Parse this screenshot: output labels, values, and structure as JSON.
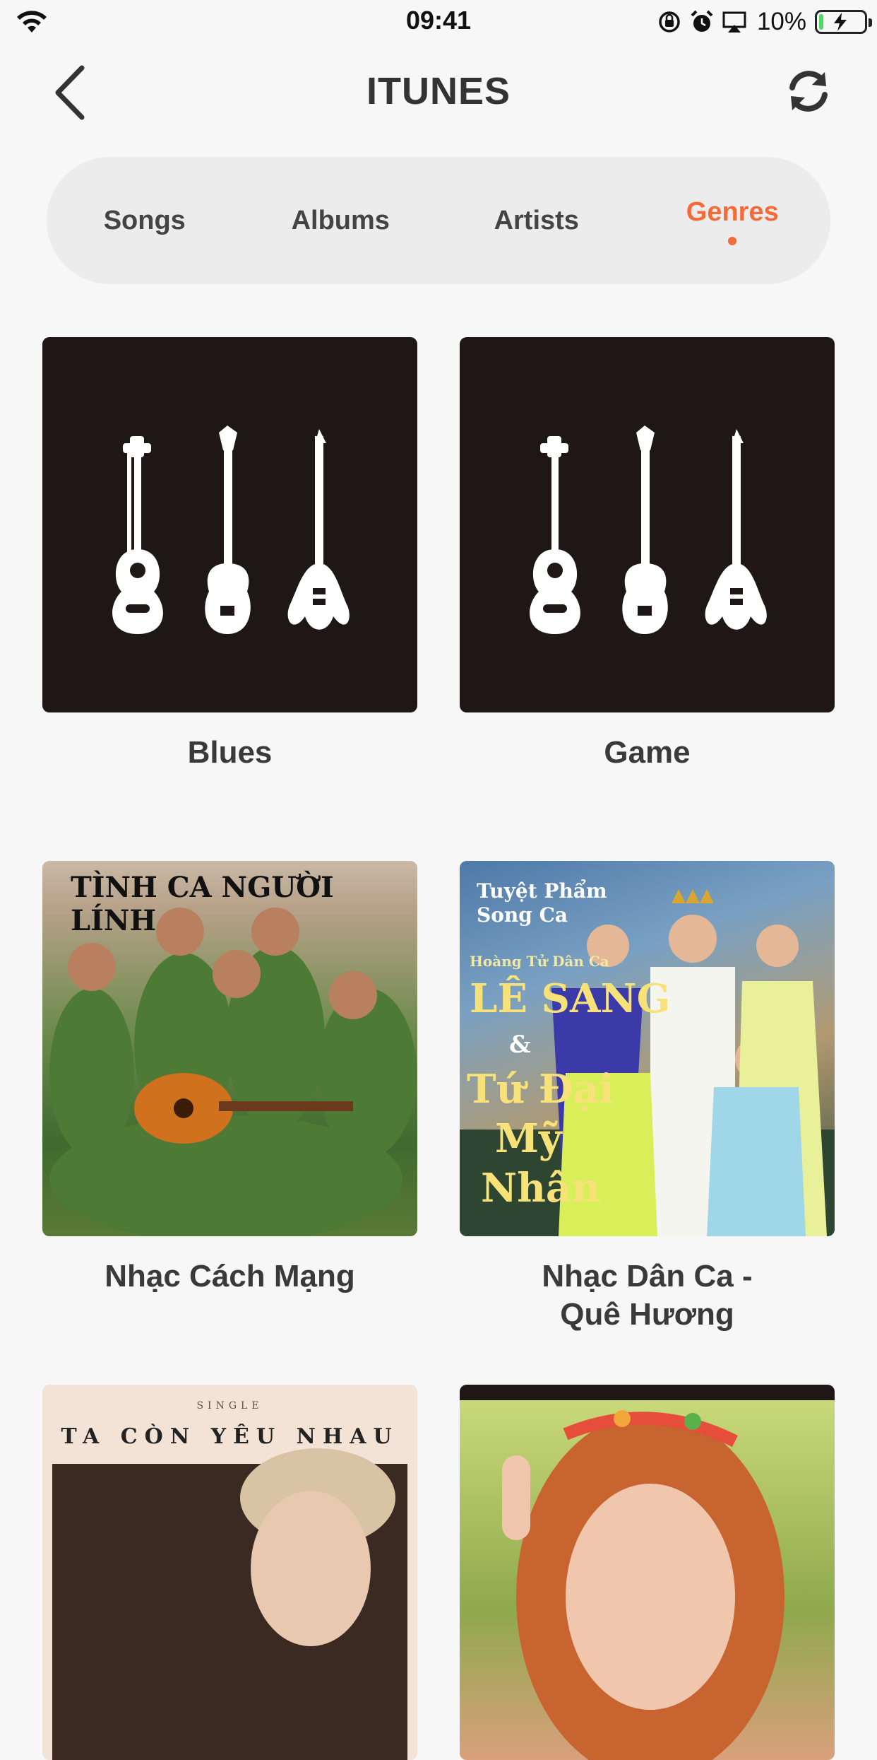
{
  "status_bar": {
    "time": "09:41",
    "battery_percent": "10%",
    "battery_level": 0.1,
    "icons": [
      "wifi-icon",
      "orientation-lock-icon",
      "alarm-icon",
      "airplay-icon",
      "battery-charging-icon"
    ]
  },
  "header": {
    "title": "ITUNES",
    "back_icon": "chevron-left-icon",
    "refresh_icon": "refresh-icon"
  },
  "tabs": {
    "items": [
      {
        "label": "Songs"
      },
      {
        "label": "Albums"
      },
      {
        "label": "Artists"
      },
      {
        "label": "Genres"
      }
    ],
    "active_index": 3
  },
  "genres": [
    {
      "name": "Blues",
      "cover": "guitars-icon"
    },
    {
      "name": "Game",
      "cover": "guitars-icon"
    },
    {
      "name": "Nhạc Cách Mạng",
      "cover_text": "TÌNH CA NGƯỜI LÍNH"
    },
    {
      "name_line1": "Nhạc Dân Ca -",
      "name_line2": "Quê Hương",
      "cover_text": [
        "Tuyệt Phẩm",
        "Song Ca",
        "Hoàng Tử Dân Ca",
        "LÊ SANG",
        "&",
        "Tứ Đại",
        "Mỹ",
        "Nhân"
      ]
    },
    {
      "name": "",
      "cover_text": [
        "SINGLE",
        "TA CÒN YÊU NHAU"
      ]
    },
    {
      "name": ""
    }
  ],
  "colors": {
    "accent": "#f26b3a",
    "background": "#f7f7f7",
    "tab_background": "#ececec",
    "cover_dark": "#1e1716"
  }
}
